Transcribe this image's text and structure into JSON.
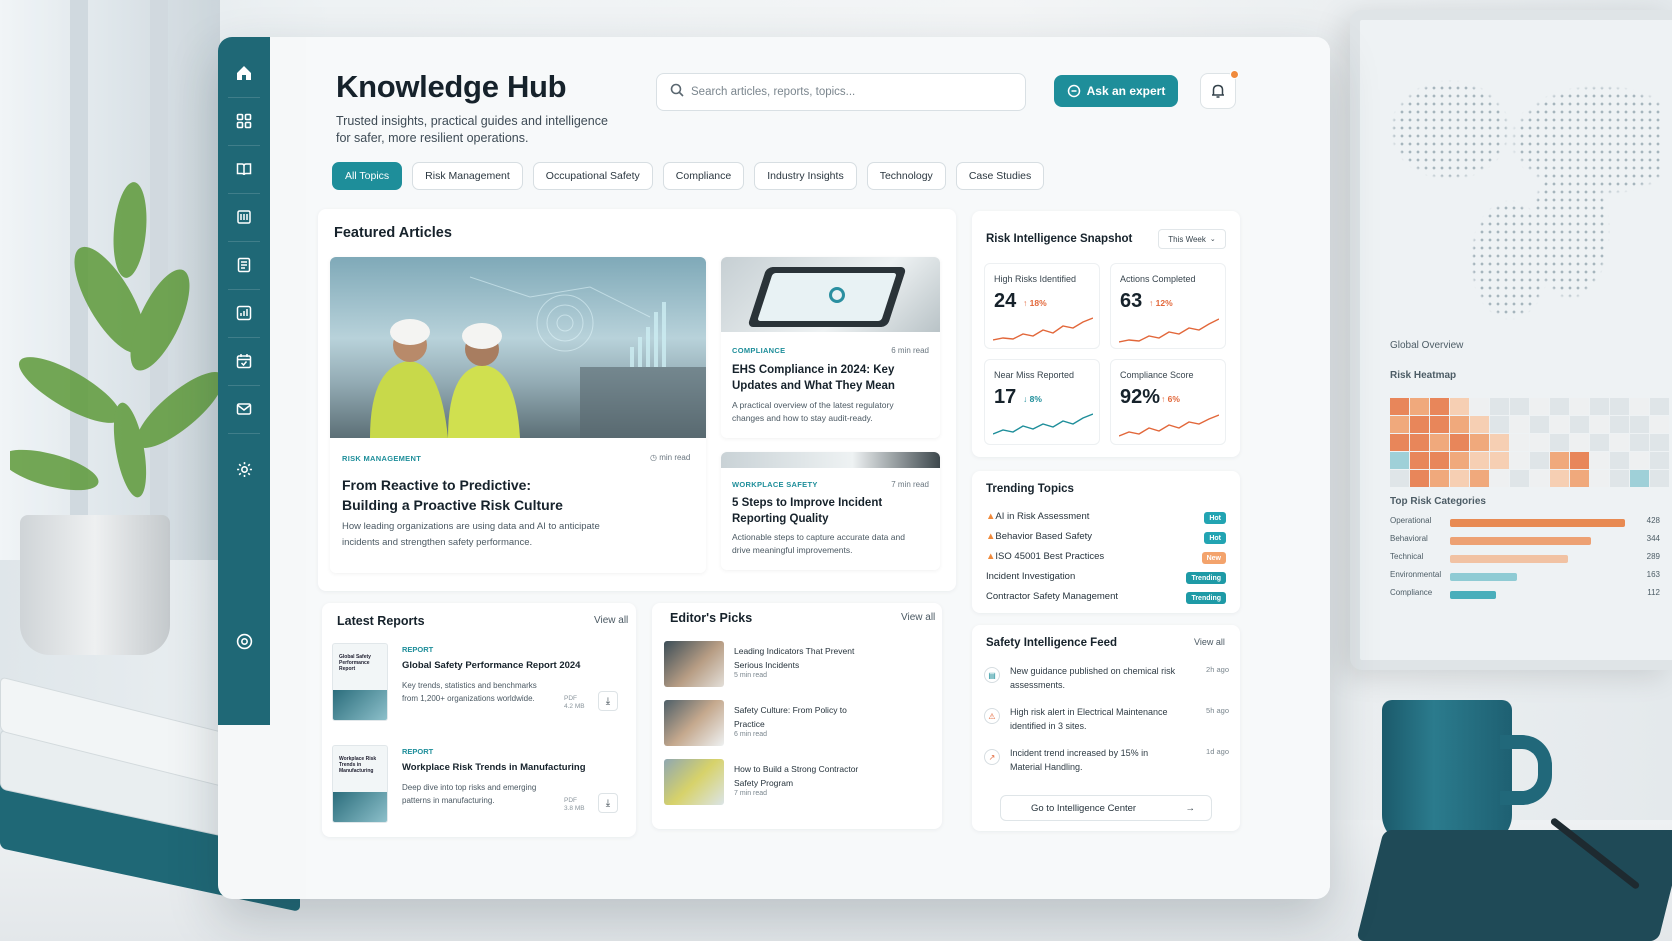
{
  "app": {
    "title": "Knowledge Hub",
    "subtitle": "Trusted insights, practical guides and intelligence for safer, more resilient operations."
  },
  "search": {
    "placeholder": "Search articles, reports, topics..."
  },
  "header": {
    "ask_label": "Ask an expert"
  },
  "colors": {
    "accent": "#1e8e9a",
    "sidebar": "#1f6876",
    "up": "#e2673a",
    "down": "#1e8e9a",
    "hot": "#22a4b2",
    "new": "#f3a36c",
    "trending": "#1e9aa6"
  },
  "topics": [
    "All Topics",
    "Risk Management",
    "Occupational Safety",
    "Compliance",
    "Industry Insights",
    "Technology",
    "Case Studies"
  ],
  "featured": {
    "title": "Featured Articles",
    "main": {
      "tag": "RISK MANAGEMENT",
      "meta": "min read",
      "title_line1": "From Reactive to Predictive:",
      "title_line2": "Building a Proactive Risk Culture",
      "desc": "How leading organizations are using data and AI to anticipate incidents and strengthen safety performance."
    },
    "side1": {
      "tag": "COMPLIANCE",
      "meta": "6 min read",
      "title": "EHS Compliance in 2024: Key Updates and What They Mean",
      "desc": "A practical overview of the latest regulatory changes and how to stay audit-ready."
    },
    "side2": {
      "tag": "WORKPLACE SAFETY",
      "meta": "7 min read",
      "title": "5 Steps to Improve Incident Reporting Quality",
      "desc": "Actionable steps to capture accurate data and drive meaningful improvements."
    }
  },
  "snapshot": {
    "title": "Risk Intelligence Snapshot",
    "period": "This Week",
    "kpis": [
      {
        "label": "High Risks Identified",
        "value": "24",
        "change": "18%",
        "dir": "up"
      },
      {
        "label": "Actions Completed",
        "value": "63",
        "change": "12%",
        "dir": "up"
      },
      {
        "label": "Near Miss Reported",
        "value": "17",
        "change": "8%",
        "dir": "down"
      },
      {
        "label": "Compliance Score",
        "value": "92%",
        "change": "6%",
        "dir": "up"
      }
    ]
  },
  "trending": {
    "title": "Trending Topics",
    "items": [
      {
        "label": "AI in Risk Assessment",
        "badge": "Hot",
        "flame": true
      },
      {
        "label": "Behavior Based Safety",
        "badge": "Hot",
        "flame": true
      },
      {
        "label": "ISO 45001 Best Practices",
        "badge": "New",
        "flame": true
      },
      {
        "label": "Incident Investigation",
        "badge": "Trending",
        "flame": false
      },
      {
        "label": "Contractor Safety Management",
        "badge": "Trending",
        "flame": false
      }
    ]
  },
  "reports": {
    "title": "Latest Reports",
    "view_all": "View all",
    "items": [
      {
        "tag": "REPORT",
        "title": "Global Safety Performance Report 2024",
        "desc": "Key trends, statistics and benchmarks from 1,200+ organizations worldwide.",
        "format": "PDF",
        "size": "4.2 MB",
        "thumb": "Global Safety Performance Report"
      },
      {
        "tag": "REPORT",
        "title": "Workplace Risk Trends in Manufacturing",
        "desc": "Deep dive into top risks and emerging patterns in manufacturing.",
        "format": "PDF",
        "size": "3.8 MB",
        "thumb": "Workplace Risk Trends in Manufacturing"
      }
    ]
  },
  "picks": {
    "title": "Editor's Picks",
    "view_all": "View all",
    "items": [
      {
        "title": "Leading Indicators That Prevent Serious Incidents",
        "meta": "5 min read"
      },
      {
        "title": "Safety Culture: From Policy to Practice",
        "meta": "6 min read"
      },
      {
        "title": "How to Build a Strong Contractor Safety Program",
        "meta": "7 min read"
      }
    ]
  },
  "feed": {
    "title": "Safety Intelligence Feed",
    "view_all": "View all",
    "items": [
      {
        "text": "New guidance published on chemical risk assessments.",
        "time": "2h ago",
        "icon": "document-icon"
      },
      {
        "text": "High risk alert in Electrical Maintenance identified in 3 sites.",
        "time": "5h ago",
        "icon": "warning-icon"
      },
      {
        "text": "Incident trend increased by 15% in Material Handling.",
        "time": "1d ago",
        "icon": "trend-icon"
      }
    ],
    "cta": "Go to Intelligence Center"
  },
  "monitor": {
    "global_label": "Global Overview",
    "heatmap_label": "Risk Heatmap",
    "categories_label": "Top Risk Categories",
    "categories": [
      {
        "name": "Operational",
        "value": "428",
        "color": "#e88a52"
      },
      {
        "name": "Behavioral",
        "value": "344",
        "color": "#eda173"
      },
      {
        "name": "Technical",
        "value": "289",
        "color": "#f1c2a3"
      },
      {
        "name": "Environmental",
        "value": "163",
        "color": "#8fcbd4"
      },
      {
        "name": "Compliance",
        "value": "112",
        "color": "#49aebb"
      }
    ]
  }
}
